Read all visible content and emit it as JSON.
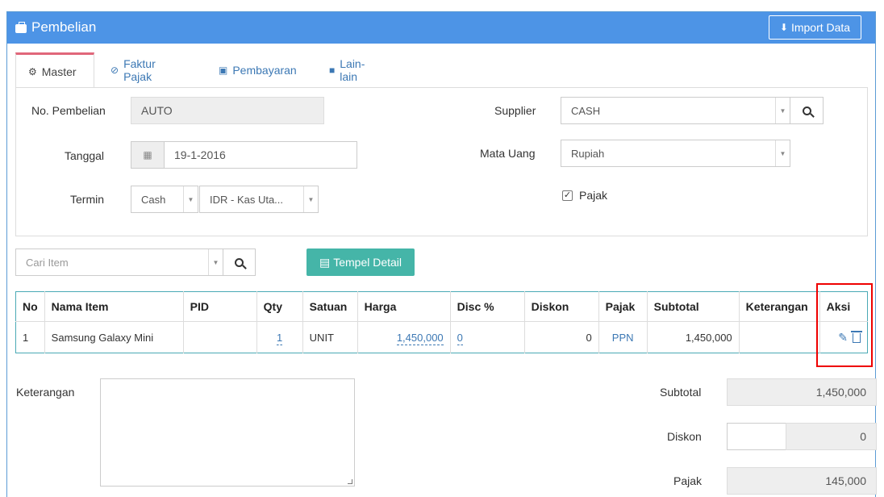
{
  "header": {
    "title": "Pembelian",
    "import_label": "Import Data"
  },
  "tabs": [
    {
      "label": "Master",
      "icon": "gears-icon"
    },
    {
      "label": "Faktur Pajak",
      "icon": "check-circle-icon"
    },
    {
      "label": "Pembayaran",
      "icon": "money-icon"
    },
    {
      "label": "Lain-lain",
      "icon": "truck-icon"
    }
  ],
  "form": {
    "no_pembelian_label": "No. Pembelian",
    "no_pembelian_value": "AUTO",
    "tanggal_label": "Tanggal",
    "tanggal_value": "19-1-2016",
    "termin_label": "Termin",
    "termin_value": "Cash",
    "kas_value": "IDR - Kas Uta...",
    "supplier_label": "Supplier",
    "supplier_value": "CASH",
    "mata_uang_label": "Mata Uang",
    "mata_uang_value": "Rupiah",
    "pajak_label": "Pajak"
  },
  "search": {
    "placeholder": "Cari Item",
    "tempel_label": "Tempel Detail"
  },
  "table": {
    "headers": [
      "No",
      "Nama Item",
      "PID",
      "Qty",
      "Satuan",
      "Harga",
      "Disc %",
      "Diskon",
      "Pajak",
      "Subtotal",
      "Keterangan",
      "Aksi"
    ],
    "rows": [
      {
        "no": "1",
        "nama": "Samsung Galaxy Mini",
        "pid": "",
        "qty": "1",
        "satuan": "UNIT",
        "harga": "1,450,000",
        "disc": "0",
        "diskon": "0",
        "pajak": "PPN",
        "subtotal": "1,450,000",
        "keterangan": ""
      }
    ]
  },
  "footer": {
    "keterangan_label": "Keterangan",
    "subtotal_label": "Subtotal",
    "subtotal_value": "1,450,000",
    "diskon_label": "Diskon",
    "diskon_value": "0",
    "pajak_label": "Pajak",
    "pajak_value": "145,000"
  },
  "colors": {
    "header_bg": "#4d94e6",
    "accent": "#45b5a8",
    "active_tab": "#e0677a",
    "highlight": "#ee0000"
  }
}
